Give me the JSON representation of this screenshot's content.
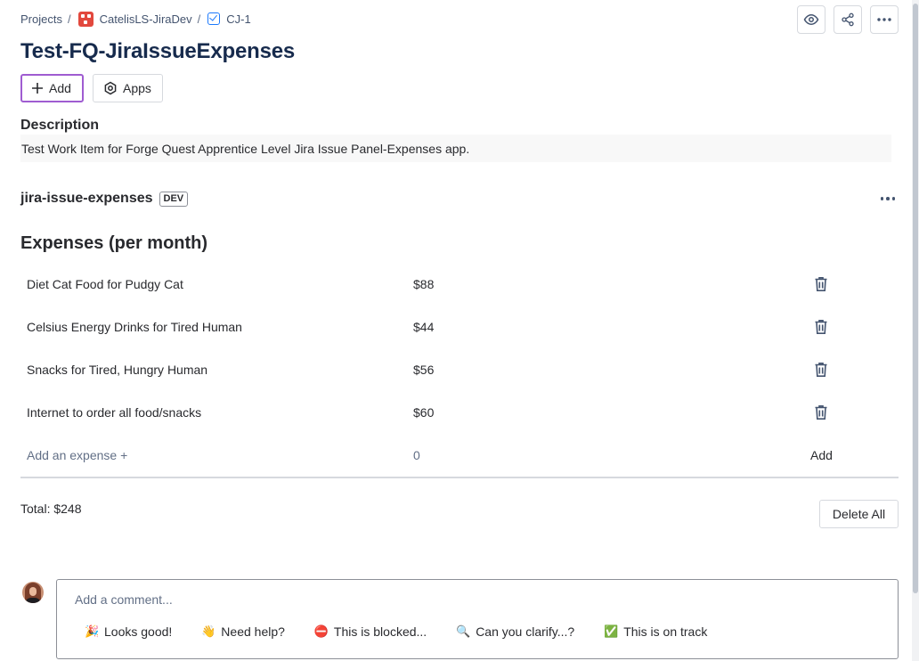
{
  "breadcrumb": {
    "projects": "Projects",
    "project": "CatelisLS-JiraDev",
    "issue_key": "CJ-1"
  },
  "header": {
    "title": "Test-FQ-JiraIssueExpenses",
    "add_label": "Add",
    "apps_label": "Apps"
  },
  "description": {
    "label": "Description",
    "text": "Test Work Item for Forge Quest Apprentice Level Jira Issue Panel-Expenses app."
  },
  "app_panel": {
    "name": "jira-issue-expenses",
    "badge": "DEV"
  },
  "expenses": {
    "title": "Expenses (per month)",
    "rows": [
      {
        "name": "Diet Cat Food for Pudgy Cat",
        "amount": "$88"
      },
      {
        "name": "Celsius Energy Drinks for Tired Human",
        "amount": "$44"
      },
      {
        "name": "Snacks for Tired, Hungry Human",
        "amount": "$56"
      },
      {
        "name": "Internet to order all food/snacks",
        "amount": "$60"
      }
    ],
    "new_name_placeholder": "Add an expense +",
    "new_amount_placeholder": "0",
    "add_label": "Add",
    "total": "Total: $248",
    "delete_all_label": "Delete All"
  },
  "comment": {
    "placeholder": "Add a comment...",
    "quick_replies": [
      {
        "emoji": "🎉",
        "label": "Looks good!"
      },
      {
        "emoji": "👋",
        "label": "Need help?"
      },
      {
        "emoji": "⛔",
        "label": "This is blocked..."
      },
      {
        "emoji": "🔍",
        "label": "Can you clarify...?"
      },
      {
        "emoji": "✅",
        "label": "This is on track"
      }
    ]
  },
  "colors": {
    "accent_add_border": "#9f5cd1",
    "project_logo": "#e2483d",
    "issue_type": "#1d7afc"
  },
  "icons": [
    "eye-icon",
    "share-icon",
    "more-icon",
    "plus-icon",
    "apps-icon",
    "trash-icon"
  ]
}
